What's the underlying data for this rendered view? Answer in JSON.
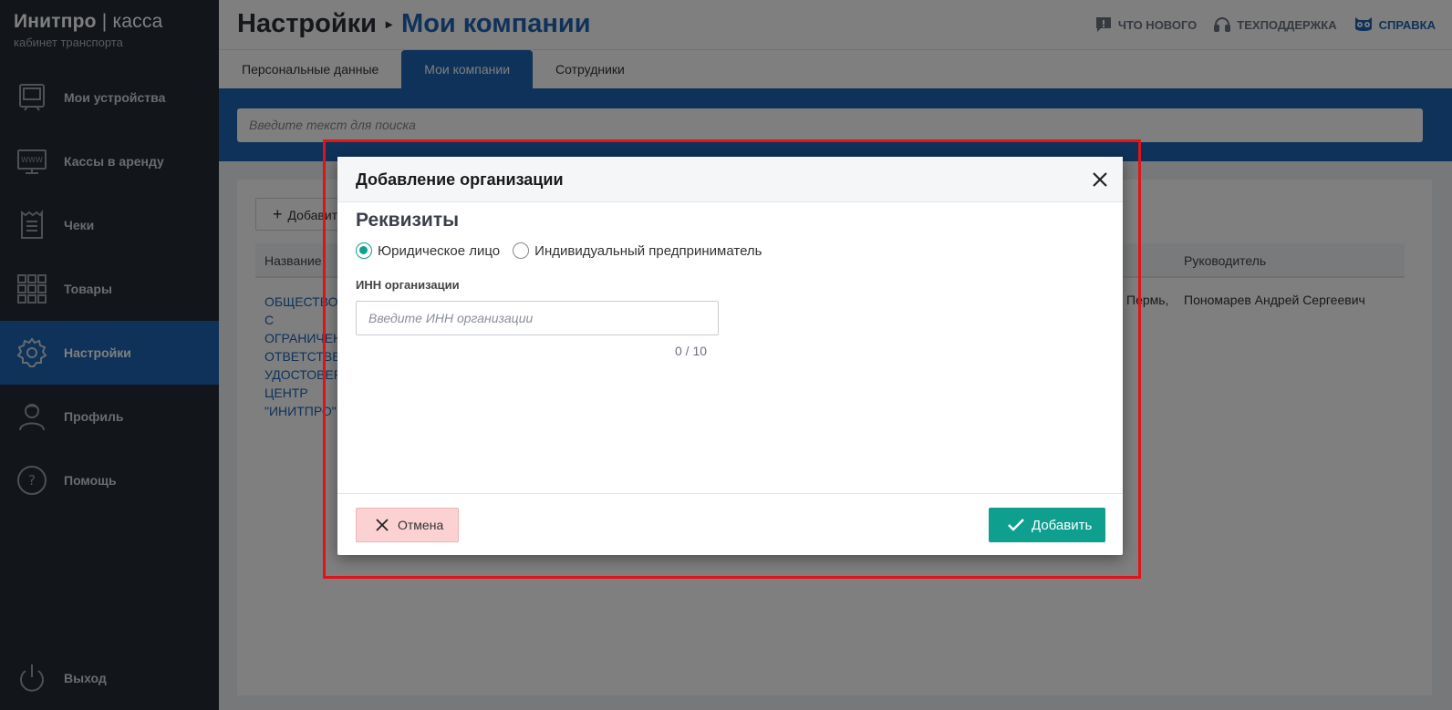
{
  "brand": {
    "name_bold": "Инитпро",
    "name_sep": " | ",
    "name_light": "касса",
    "subtitle": "кабинет транспорта"
  },
  "sidebar": {
    "items": [
      {
        "label": "Мои устройства",
        "icon": "device-icon"
      },
      {
        "label": "Кассы в аренду",
        "icon": "www-icon"
      },
      {
        "label": "Чеки",
        "icon": "receipt-icon"
      },
      {
        "label": "Товары",
        "icon": "grid-icon"
      },
      {
        "label": "Настройки",
        "icon": "gear-icon",
        "active": true
      },
      {
        "label": "Профиль",
        "icon": "user-icon"
      },
      {
        "label": "Помощь",
        "icon": "help-icon"
      }
    ],
    "logout": "Выход"
  },
  "header": {
    "breadcrumb_root": "Настройки",
    "breadcrumb_current": "Мои компании",
    "links": {
      "news": "ЧТО НОВОГО",
      "support": "ТЕХПОДДЕРЖКА",
      "help": "СПРАВКА"
    }
  },
  "tabs": [
    {
      "label": "Персональные данные"
    },
    {
      "label": "Мои компании",
      "active": true
    },
    {
      "label": "Сотрудники"
    }
  ],
  "search": {
    "placeholder": "Введите текст для поиска"
  },
  "table": {
    "add_button": "Добавить",
    "columns": {
      "name": "Название",
      "head": "Руководитель"
    },
    "row": {
      "name": "ОБЩЕСТВО С ОГРАНИЧЕННОЙ ОТВЕТСТВЕННОСТЬЮ УДОСТОВЕРЯЮЩИЙ ЦЕНТР \"ИНИТПРО\"",
      "address_fragment": "Пермь,",
      "head": "Пономарев Андрей Сергеевич"
    }
  },
  "modal": {
    "title": "Добавление организации",
    "section": "Реквизиты",
    "radios": [
      {
        "label": "Юридическое лицо",
        "checked": true
      },
      {
        "label": "Индивидуальный предприниматель",
        "checked": false
      }
    ],
    "inn_label": "ИНН организации",
    "inn_placeholder": "Введите ИНН организации",
    "inn_counter": "0 / 10",
    "cancel_label": "Отмена",
    "submit_label": "Добавить"
  },
  "colors": {
    "accent": "#1c64b4",
    "sidebar": "#252a35",
    "success": "#0f9f8f",
    "danger_bg": "#fbd1d1",
    "highlight": "#e0141b"
  }
}
